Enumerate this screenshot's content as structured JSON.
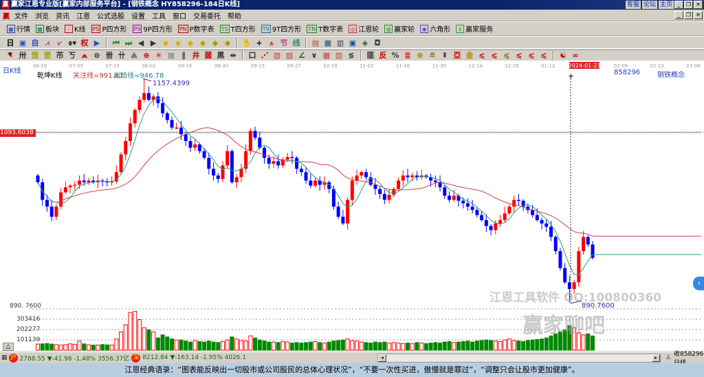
{
  "title": "赢家江恩专业版[赢家内部服务平台] - [钢铁概念    HY858296-184日K线]",
  "title_links": [
    "客服",
    "论坛",
    "主页"
  ],
  "menu": [
    "文件",
    "浏览",
    "资讯",
    "江恩",
    "公式选股",
    "设置",
    "工具",
    "窗口",
    "交易委托",
    "帮助"
  ],
  "toolbar1": [
    {
      "label": "行情",
      "glyph": "▦",
      "color": "#1a3f9a",
      "icon": "quote-icon"
    },
    {
      "label": "板块",
      "glyph": "▩",
      "color": "#1a7a3a",
      "icon": "sector-icon"
    },
    {
      "label": "K线",
      "glyph": "⫶",
      "color": "#c00000",
      "icon": "kline-icon"
    },
    {
      "label": "P四方形",
      "glyph": "PS",
      "color": "#c00000",
      "icon": "p-square-icon"
    },
    {
      "label": "9P四方形",
      "glyph": "P9",
      "color": "#a000a0",
      "icon": "9p-square-icon"
    },
    {
      "label": "P数字表",
      "glyph": "PN",
      "color": "#c00000",
      "icon": "p-number-icon"
    },
    {
      "label": "T四方形",
      "glyph": "TS",
      "color": "#1a8a1a",
      "icon": "t-square-icon"
    },
    {
      "label": "9T四方形",
      "glyph": "T9",
      "color": "#1a6a9a",
      "icon": "9t-square-icon"
    },
    {
      "label": "T数字表",
      "glyph": "TN",
      "color": "#1a8a1a",
      "icon": "t-number-icon"
    },
    {
      "label": "江恩轮",
      "glyph": "◎",
      "color": "#c03030",
      "icon": "gann-wheel-icon"
    },
    {
      "label": "赢家轮",
      "glyph": "◍",
      "color": "#2a8a2a",
      "icon": "winner-wheel-icon"
    },
    {
      "label": "六角形",
      "glyph": "◉",
      "color": "#6040c0",
      "icon": "hexagon-icon"
    },
    {
      "label": "赢家服务",
      "glyph": "$",
      "color": "#2aa02a",
      "icon": "service-icon"
    }
  ],
  "toolbar2": [
    {
      "g": "日▾",
      "c": "#000",
      "n": "period-dropdown"
    },
    {
      "g": "▣",
      "c": "#3050c0",
      "n": "chart-type-icon"
    },
    {
      "g": "自",
      "c": "#3050c0",
      "n": "auto-icon"
    },
    {
      "g": "⩘",
      "c": "#c04080",
      "n": "zoom-in-icon"
    },
    {
      "g": "⩗",
      "c": "#c04080",
      "n": "zoom-out-icon"
    },
    {
      "g": "⌽▾",
      "c": "#000",
      "n": "candle-style-icon"
    },
    {
      "g": "权",
      "c": "#c00",
      "n": "rights-icon"
    },
    {
      "g": "▶",
      "c": "#2050c0",
      "n": "flag-icon"
    },
    {
      "sep": true
    },
    {
      "g": "⏮",
      "c": "#1a8a1a",
      "n": "first-icon"
    },
    {
      "g": "⏭",
      "c": "#1a8a1a",
      "n": "last-icon"
    },
    {
      "g": "◀",
      "c": "#333",
      "n": "prev-icon"
    },
    {
      "g": "▶",
      "c": "#333",
      "n": "next-icon"
    },
    {
      "g": "◆",
      "c": "#e0b000",
      "n": "diamond1-icon"
    },
    {
      "g": "◆",
      "c": "#e0b000",
      "n": "diamond2-icon"
    },
    {
      "g": "◆",
      "c": "#d0b000",
      "n": "diamond3-icon"
    },
    {
      "g": "◆",
      "c": "#c0a000",
      "n": "diamond4-icon"
    },
    {
      "g": "◆",
      "c": "#a0a000",
      "n": "diamond5-icon"
    },
    {
      "g": "◆",
      "c": "#a0a000",
      "n": "diamond6-icon"
    },
    {
      "sep": true
    },
    {
      "g": "✋",
      "c": "#555",
      "n": "hand-icon"
    },
    {
      "g": "+",
      "c": "#000",
      "n": "crosshair-icon"
    },
    {
      "g": "⩚",
      "c": "#c04040",
      "n": "line-icon"
    },
    {
      "g": "节",
      "c": "#c04080",
      "n": "festival-icon"
    },
    {
      "g": "线",
      "c": "#2a8a6a",
      "n": "draw-icon"
    },
    {
      "sep": true
    },
    {
      "g": "▤",
      "c": "#c04040",
      "n": "calendar-icon"
    },
    {
      "g": "▦",
      "c": "#205070",
      "n": "calculator-icon"
    },
    {
      "g": "▥",
      "c": "#304060",
      "n": "notes-icon"
    },
    {
      "g": "▣",
      "c": "#1050a0",
      "n": "save-icon"
    },
    {
      "g": "◈",
      "c": "#306030",
      "n": "network-icon"
    },
    {
      "g": "◘",
      "c": "#304050",
      "n": "transfer-icon"
    }
  ],
  "toolbar3": [
    {
      "g": "✎",
      "c": "#c00",
      "n": "pen-icon"
    },
    {
      "g": "卅",
      "c": "#333",
      "n": "grid-icon"
    },
    {
      "g": "罡",
      "c": "#a0a000",
      "n": "gann-fan-icon"
    },
    {
      "g": "罡",
      "c": "#a0a000",
      "n": "gann-fan2-icon"
    },
    {
      "g": "芇",
      "c": "#333",
      "n": "fib-icon"
    },
    {
      "g": "ㄎ",
      "c": "#333",
      "n": "cycle-icon"
    },
    {
      "g": "⩕",
      "c": "#c00",
      "n": "angle-icon"
    },
    {
      "g": "⊜",
      "c": "#333",
      "n": "circle-icon"
    },
    {
      "g": "卌",
      "c": "#333",
      "n": "parallel-icon"
    },
    {
      "g": "卄",
      "c": "#333",
      "n": "period-lines-icon"
    },
    {
      "g": "⟁",
      "c": "#666",
      "n": "triangle-icon"
    },
    {
      "g": "⊕",
      "c": "#c00",
      "n": "target-icon"
    },
    {
      "g": "✳",
      "c": "#c00",
      "n": "star-icon"
    },
    {
      "g": "▩",
      "c": "#888",
      "n": "box-icon"
    },
    {
      "g": "∥",
      "c": "#333",
      "n": "channel-icon"
    },
    {
      "g": "井",
      "c": "#c00",
      "n": "pattern-icon"
    },
    {
      "g": "菌",
      "c": "#c00",
      "n": "square-icon"
    },
    {
      "g": "黑",
      "c": "#333",
      "n": "blackbox-icon"
    },
    {
      "g": "⇹",
      "c": "#333",
      "n": "span-icon"
    },
    {
      "sep": true
    },
    {
      "g": "口",
      "c": "#333",
      "n": "rect-icon"
    },
    {
      "g": "⋰",
      "c": "#c00",
      "n": "speed-icon"
    },
    {
      "g": "▧",
      "c": "#c04040",
      "n": "grid2-icon"
    },
    {
      "g": "▨",
      "c": "#c04040",
      "n": "grid3-icon"
    },
    {
      "g": "∠",
      "c": "#333",
      "n": "angle2-icon"
    },
    {
      "g": "∨",
      "c": "#333",
      "n": "wave-icon"
    },
    {
      "g": "▦",
      "c": "#c04040",
      "n": "table-icon"
    },
    {
      "g": "▥",
      "c": "#c04040",
      "n": "table2-icon"
    },
    {
      "g": "≶",
      "c": "#333",
      "n": "lines-icon"
    },
    {
      "sep": true
    },
    {
      "g": "匪",
      "c": "#333",
      "n": "bars-icon"
    },
    {
      "g": "反",
      "c": "#c00",
      "n": "reverse-icon"
    },
    {
      "g": "%",
      "c": "#333",
      "n": "percent-icon"
    },
    {
      "g": "≣",
      "c": "#c00",
      "n": "percent-lines-icon"
    },
    {
      "g": "⊛",
      "c": "#a08000",
      "n": "gold-circle-icon"
    },
    {
      "g": "≘",
      "c": "#806000",
      "n": "gold-lines-icon"
    },
    {
      "g": "⇞",
      "c": "#333",
      "n": "arrow-lines-icon"
    },
    {
      "g": "亞",
      "c": "#c00",
      "n": "sub-icon"
    },
    {
      "g": "金",
      "c": "#c08000",
      "n": "gold-icon"
    },
    {
      "g": "⩽",
      "c": "#c00",
      "n": "le-icon"
    },
    {
      "g": "⩽",
      "c": "#c00",
      "n": "le2-icon"
    },
    {
      "g": "⩽",
      "c": "#806000",
      "n": "le3-icon"
    },
    {
      "g": "⩽",
      "c": "#c00",
      "n": "le4-icon"
    },
    {
      "g": "⩽",
      "c": "#c00",
      "n": "le5-icon"
    },
    {
      "g": "⩽",
      "c": "#c00",
      "n": "le6-icon"
    },
    {
      "sep": true
    },
    {
      "g": "☯",
      "c": "#c00",
      "n": "yinyang-icon"
    },
    {
      "g": "∞",
      "c": "#c00",
      "n": "infinity-icon"
    }
  ],
  "chart": {
    "period_label": "日K线",
    "indicator_name": "乾坤K线",
    "focus_line": "关注线=991.61",
    "exit_line": "出局线=946.78",
    "symbol": "858296",
    "symbol_name": "钢铁概念",
    "high_label": "1157.4399",
    "low_label": "890.7600",
    "current_price_label": "1093.6038",
    "left_low_label": "890. 7600",
    "volume_ticks": [
      "303416",
      "202277",
      "101139"
    ],
    "triangle_button": "△",
    "watermark1": "江恩工具软件 QQ:100800360",
    "watermark2": "赢家聊吧",
    "side_button": "‹"
  },
  "chart_data": {
    "type": "candlestick",
    "dates": [
      "06-19",
      "07-05",
      "07-19",
      "08-02",
      "08-16",
      "08-30",
      "09-13",
      "09-27",
      "10-19",
      "11-02",
      "11-16",
      "11-30",
      "12-14",
      "12-28",
      "01-12",
      "2024-01-23",
      "02-09",
      "02-23",
      "03-08"
    ],
    "highlight_date": "2024-01-23",
    "ylim": [
      890.76,
      1157.44
    ],
    "ma_periods": [
      5,
      20
    ],
    "close": [
      1034,
      1013,
      1005,
      993,
      1005,
      1022,
      1028,
      1030,
      1031,
      1036,
      1034,
      1036,
      1034,
      1036,
      1035,
      1034,
      1035,
      1046,
      1067,
      1083,
      1104,
      1120,
      1132,
      1140,
      1132,
      1136,
      1128,
      1116,
      1108,
      1099,
      1099,
      1091,
      1083,
      1075,
      1079,
      1071,
      1063,
      1050,
      1042,
      1038,
      1054,
      1071,
      1034,
      1040,
      1050,
      1071,
      1095,
      1087,
      1075,
      1063,
      1056,
      1059,
      1054,
      1061,
      1064,
      1063,
      1050,
      1046,
      1036,
      1030,
      1036,
      1031,
      1034,
      1026,
      1005,
      993,
      985,
      1013,
      1036,
      1042,
      1046,
      1040,
      1031,
      1026,
      1020,
      1013,
      1019,
      1026,
      1036,
      1042,
      1040,
      1042,
      1040,
      1042,
      1040,
      1036,
      1034,
      1028,
      1018,
      1013,
      1018,
      1012,
      1009,
      1005,
      1001,
      995,
      989,
      982,
      977,
      985,
      989,
      997,
      1005,
      1013,
      1012,
      1005,
      1001,
      995,
      989,
      985,
      981,
      969,
      952,
      932,
      915,
      907,
      915,
      952,
      969,
      960,
      944
    ],
    "volume": [
      60000,
      62000,
      65000,
      60000,
      55000,
      50000,
      55000,
      62000,
      58000,
      90000,
      62000,
      52000,
      50000,
      50000,
      55000,
      52000,
      50000,
      110000,
      180000,
      250000,
      370000,
      380000,
      300000,
      220000,
      200000,
      180000,
      120000,
      150000,
      130000,
      110000,
      100000,
      100000,
      90000,
      80000,
      95000,
      85000,
      80000,
      90000,
      80000,
      75000,
      85000,
      100000,
      130000,
      110000,
      95000,
      90000,
      140000,
      120000,
      100000,
      90000,
      80000,
      80000,
      75000,
      85000,
      80000,
      70000,
      75000,
      70000,
      75000,
      80000,
      85000,
      75000,
      70000,
      80000,
      90000,
      95000,
      100000,
      110000,
      95000,
      90000,
      80000,
      75000,
      70000,
      80000,
      75000,
      80000,
      70000,
      75000,
      70000,
      65000,
      70000,
      65000,
      75000,
      70000,
      65000,
      70000,
      75000,
      70000,
      80000,
      85000,
      75000,
      80000,
      85000,
      90000,
      80000,
      90000,
      95000,
      100000,
      95000,
      90000,
      85000,
      100000,
      110000,
      95000,
      90000,
      85000,
      95000,
      100000,
      105000,
      110000,
      120000,
      140000,
      160000,
      180000,
      200000,
      240000,
      220000,
      170000,
      150000,
      160000,
      140000
    ]
  },
  "status": {
    "sh_badge": "沪",
    "sh_text": "2788.55 ▼-41.98 -1.48% 3556.37亿",
    "sz_badge": "深",
    "sz_text": "8212.84 ▼-163.14 -1.95% 4026.1",
    "right_text": "收858296日线"
  },
  "quote": "江恩经典语录：“图表能反映出一切股市或公司股民的总体心理状况”，“不要一次性买进，傲慢就是罪过”，“调整只会让股市更加健康”。",
  "colors": {
    "up": "#ff0000",
    "down": "#0000ff",
    "ma_short": "#2a9a8a",
    "ma_long": "#d04040",
    "vol_down": "#008800"
  }
}
